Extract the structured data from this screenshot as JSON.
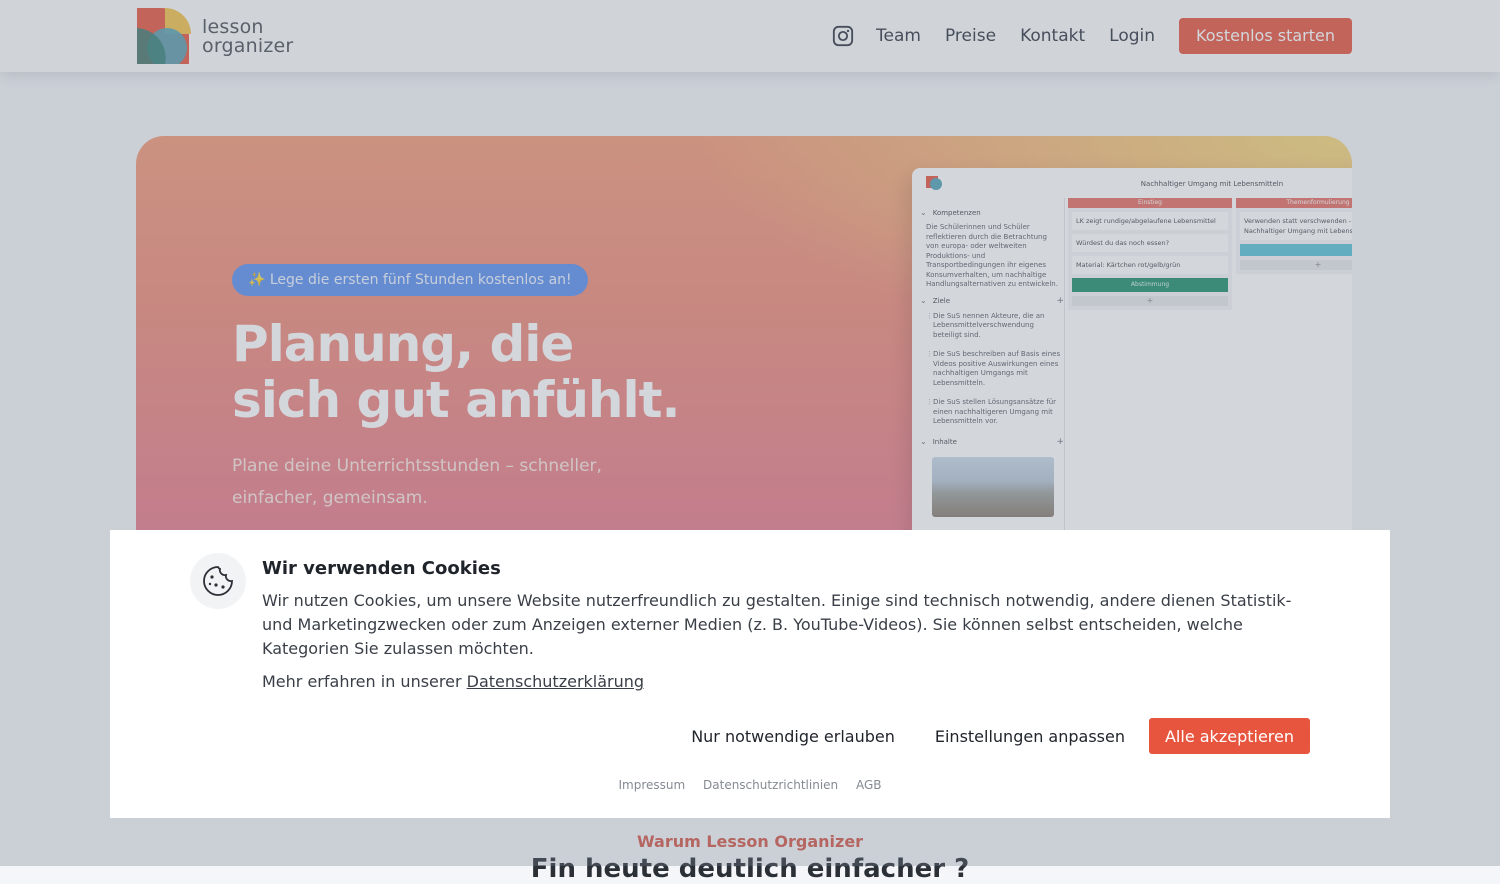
{
  "header": {
    "logo_line1": "lesson",
    "logo_line2": "organizer",
    "nav": [
      "Team",
      "Preise",
      "Kontakt",
      "Login"
    ],
    "cta": "Kostenlos starten",
    "icons": {
      "social": "instagram-icon"
    }
  },
  "hero": {
    "badge": "✨ Lege die ersten fünf Stunden kostenlos an!",
    "title": "Planung, die sich gut anfühlt.",
    "subtitle": "Plane deine Unterrichtsstunden – schneller, einfacher, gemeinsam."
  },
  "preview": {
    "title": "Nachhaltiger Umgang mit Lebensmitteln",
    "competencies_label": "Kompetenzen",
    "competencies_text": "Die Schülerinnen und Schüler reflektieren durch die Betrachtung von europa- oder weltweiten Produktions- und Transportbedingungen ihr eigenes Konsumverhalten, um nachhaltige Handlungsalternativen zu entwickeln.",
    "goals_label": "Ziele",
    "goals": [
      "Die SuS nennen Akteure, die an Lebensmittelverschwendung beteiligt sind.",
      "Die SuS beschreiben auf Basis eines Videos positive Auswirkungen eines nachhaltigen Umgangs mit Lebensmitteln.",
      "Die SuS stellen Lösungsansätze für einen nachhaltigeren Umgang mit Lebensmitteln vor."
    ],
    "contents_label": "Inhalte",
    "col1": {
      "head": "Einstieg",
      "cards": [
        "LK zeigt rundige/abgelaufene Lebensmittel",
        "Würdest du das noch essen?",
        "Material: Kärtchen rot/gelb/grün"
      ],
      "action": "Abstimmung"
    },
    "col2": {
      "head": "Themenformulierung",
      "cards": [
        "Verwenden statt verschwenden - Nachhaltiger Umgang mit Lebensmitteln"
      ]
    }
  },
  "cookie": {
    "title": "Wir verwenden Cookies",
    "text": "Wir nutzen Cookies, um unsere Website nutzerfreundlich zu gestalten. Einige sind technisch notwendig, andere dienen Statistik- und Marketingzwecken oder zum Anzeigen externer Medien (z. B. YouTube-Videos). Sie können selbst entscheiden, welche Kategorien Sie zulassen möchten.",
    "more_prefix": "Mehr erfahren in unserer",
    "more_link": "Datenschutzerklärung",
    "btn_necessary": "Nur notwendige erlauben",
    "btn_settings": "Einstellungen anpassen",
    "btn_accept": "Alle akzeptieren",
    "footer_links": [
      "Impressum",
      "Datenschutzrichtlinien",
      "AGB"
    ],
    "accent": "#e8553f"
  },
  "below": {
    "label": "Warum Lesson Organizer",
    "title": "Fin  heute deutlich einfacher ?"
  }
}
